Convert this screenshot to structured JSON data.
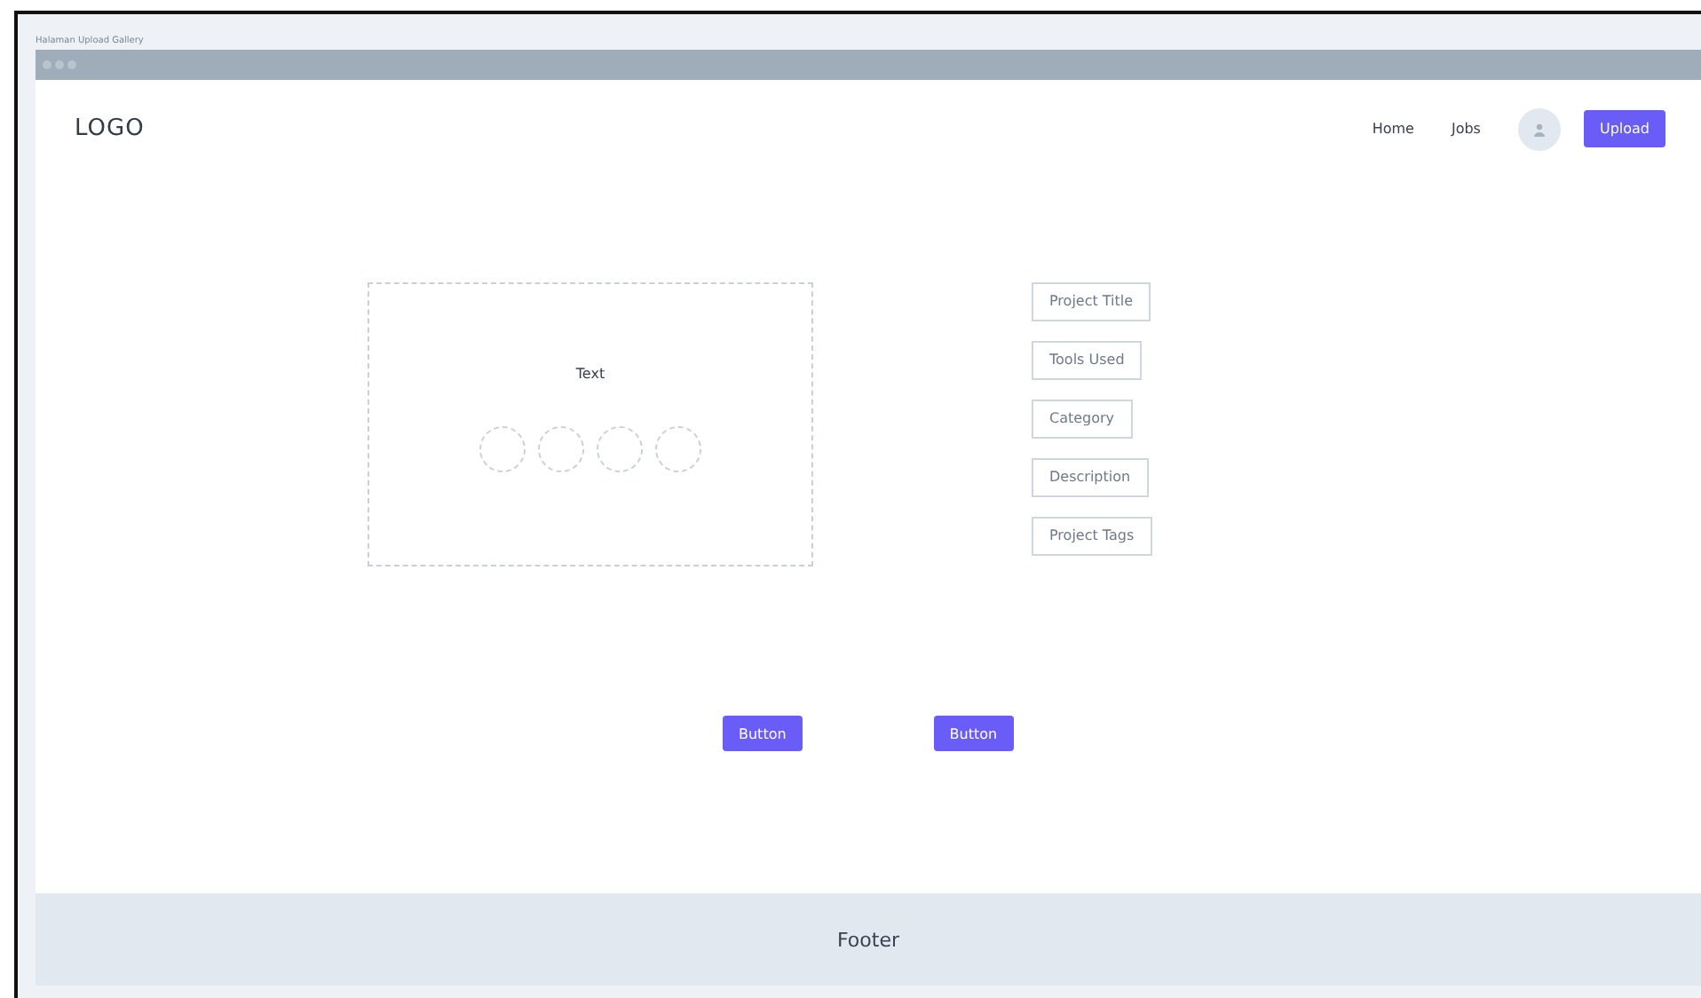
{
  "page_title": "Halaman Upload Gallery",
  "header": {
    "logo": "LOGO",
    "nav": [
      {
        "label": "Home"
      },
      {
        "label": "Jobs"
      }
    ],
    "upload_button": "Upload"
  },
  "dropzone": {
    "text": "Text"
  },
  "fields": [
    {
      "label": "Project Title"
    },
    {
      "label": "Tools Used"
    },
    {
      "label": "Category"
    },
    {
      "label": "Description"
    },
    {
      "label": "Project Tags"
    }
  ],
  "buttons": [
    "Button",
    "Button"
  ],
  "footer": "Footer"
}
